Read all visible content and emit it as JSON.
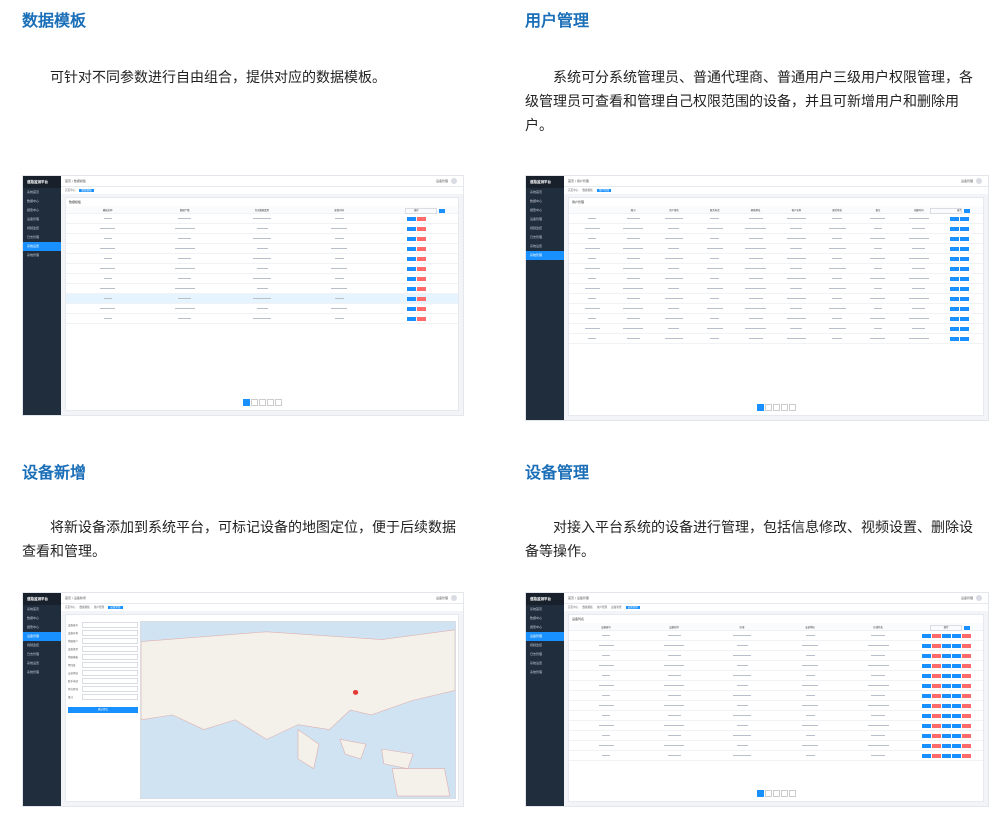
{
  "sections": [
    {
      "title": "数据模板",
      "desc": "可针对不同参数进行自由组合，提供对应的数据模板。",
      "shot": {
        "brand": "道路监测平台",
        "breadcrumb": "首页 / 数据模板",
        "tabs": [
          "首页中心",
          "数据模板"
        ],
        "panel_title": "数据模板",
        "columns": [
          "模板名称",
          "数据个数",
          "包含数据类型",
          "更新时间",
          "操作"
        ],
        "rows": 11,
        "highlight_row": 8,
        "pager": "1 2 3 ... 26"
      }
    },
    {
      "title": "用户管理",
      "desc": "系统可分系统管理员、普通代理商、普通用户三级用户权限管理，各级管理员可查看和管理自己权限范围的设备，并且可新增用户和删除用户。",
      "shot": {
        "brand": "道路监测平台",
        "breadcrumb": "首页 / 用户管理",
        "tabs": [
          "首页中心",
          "数据模板",
          "用户管理"
        ],
        "panel_title": "用户管理",
        "columns": [
          "",
          "账号",
          "用户角色",
          "联系电话",
          "邮箱地址",
          "客户名称",
          "联系地址",
          "备注",
          "创建时间",
          "操作"
        ],
        "rows": 13,
        "pager": "1 2 3 ... 24"
      }
    },
    {
      "title": "设备新增",
      "desc": "将新设备添加到系统平台，可标记设备的地图定位，便于后续数据查看和管理。",
      "shot": {
        "brand": "道路监测平台",
        "breadcrumb": "首页 / 设备新增",
        "tabs": [
          "首页中心",
          "数据模板",
          "用户管理",
          "设备新增"
        ],
        "form_labels": [
          "设备编号",
          "设备名称",
          "所属客户",
          "设备类型",
          "所属模板",
          "经纬度",
          "安装地址",
          "联系电话",
          "所在区域",
          "备注"
        ],
        "submit": "确认提交"
      }
    },
    {
      "title": "设备管理",
      "desc": "对接入平台系统的设备进行管理，包括信息修改、视频设置、删除设备等操作。",
      "shot": {
        "brand": "道路监测平台",
        "breadcrumb": "首页 / 设备管理",
        "tabs": [
          "首页中心",
          "数据模板",
          "用户管理",
          "设备新增",
          "设备管理"
        ],
        "panel_title": "设备列表",
        "columns": [
          "设备编号",
          "设备名称",
          "区域",
          "安装地址",
          "在线状态",
          "操作"
        ],
        "rows": 13,
        "pager": "1 2 3 ... 20"
      }
    }
  ],
  "sidebar_menu": [
    "系统首页",
    "数据中心",
    "报警中心",
    "设备管理",
    "视频监控",
    "日志管理",
    "系统设置",
    "系统管理"
  ]
}
